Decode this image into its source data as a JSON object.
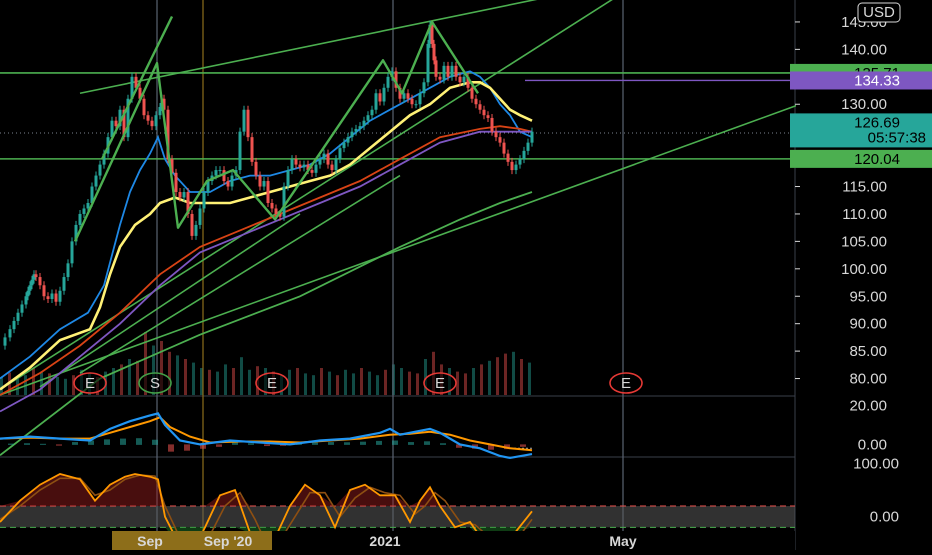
{
  "chart_data": {
    "type": "line",
    "currency": "USD",
    "price_axis": {
      "ylim": [
        77,
        149
      ],
      "ticks": [
        145,
        140,
        135,
        130,
        125,
        120,
        115,
        110,
        105,
        100,
        95,
        90,
        85,
        80
      ],
      "tick_labels": [
        "145.00",
        "140.00",
        "135.00",
        "130.00",
        "125.00",
        "120.00",
        "115.00",
        "110.00",
        "105.00",
        "100.00",
        "95.00",
        "90.00",
        "85.00",
        "80.00"
      ]
    },
    "price_tags": {
      "resistance": {
        "label": "135.71",
        "value": 135.71,
        "color": "#4caf50"
      },
      "alert": {
        "label": "134.33",
        "value": 134.33,
        "color": "#7e57c2"
      },
      "last": {
        "label": "126.69",
        "countdown": "05:57:38",
        "value": 126.69,
        "color": "#26a69a"
      },
      "support": {
        "label": "120.04",
        "value": 120.04,
        "color": "#4caf50"
      }
    },
    "close_series": {
      "name": "",
      "x": [
        0,
        5,
        10,
        14,
        18,
        22,
        26,
        28,
        30,
        32,
        34,
        36,
        40,
        44,
        48,
        52,
        56,
        60,
        64,
        68,
        72,
        76,
        80,
        84,
        88,
        92,
        96,
        100,
        104,
        108,
        112,
        116,
        120,
        124,
        128,
        132,
        136,
        140,
        144,
        148,
        152,
        156,
        160,
        162,
        164,
        168,
        172,
        176,
        180,
        184,
        188,
        192,
        196,
        200,
        204,
        208,
        212,
        216,
        220,
        224,
        228,
        232,
        236,
        240,
        244,
        248,
        252,
        256,
        260,
        264,
        268,
        272,
        276,
        280,
        284,
        288,
        292,
        296,
        300,
        304,
        308,
        312,
        316,
        320,
        324,
        328,
        332,
        336,
        340,
        344,
        348,
        352,
        356,
        360,
        364,
        368,
        372,
        376,
        380,
        384,
        388,
        392,
        396,
        400,
        404,
        408,
        412,
        416,
        420,
        424,
        428,
        430,
        432,
        434,
        436,
        440,
        444,
        448,
        452,
        456,
        460,
        464,
        468,
        472,
        476,
        480,
        484,
        488,
        492,
        496,
        500,
        504,
        508,
        512,
        516,
        520,
        524,
        528,
        532
      ],
      "y": [
        86,
        87.5,
        89,
        90.5,
        92,
        93.5,
        95,
        96,
        97,
        98,
        99,
        98.5,
        97,
        95,
        94.5,
        95.5,
        94,
        96,
        98.5,
        101,
        105,
        108,
        110,
        111,
        112,
        115,
        117,
        119,
        121,
        124,
        127,
        126,
        129,
        124,
        131,
        135,
        133,
        131,
        128,
        127,
        126,
        128,
        129.5,
        131,
        129,
        120,
        117.5,
        114,
        113,
        114,
        110,
        106,
        108,
        111,
        114,
        116,
        117,
        118,
        118,
        116,
        115,
        117,
        118,
        125,
        129,
        124,
        119.5,
        117,
        115,
        116,
        112,
        111,
        110,
        109.5,
        115,
        118,
        120,
        119,
        118.5,
        119,
        118,
        117.5,
        119,
        120,
        121,
        119,
        118,
        120,
        122,
        123,
        124,
        125,
        125.5,
        126,
        127,
        128,
        129,
        132,
        130.5,
        133,
        135,
        136,
        133,
        131,
        132,
        131,
        130,
        130,
        132,
        134,
        141,
        144.5,
        141,
        138,
        135,
        134.5,
        137,
        135,
        137,
        135,
        134,
        135,
        133,
        131,
        130,
        129,
        128,
        127.5,
        125,
        124,
        123,
        121,
        119.5,
        118,
        119,
        120,
        121.5,
        123,
        125,
        126.69
      ]
    },
    "ema_series": [
      {
        "name": "",
        "color": "#1e88e5",
        "x": [
          0,
          30,
          60,
          88,
          104,
          120,
          130,
          140,
          150,
          158,
          165,
          175,
          190,
          210,
          230,
          250,
          270,
          290,
          310,
          330,
          350,
          370,
          390,
          410,
          430,
          450,
          470,
          480,
          490,
          500,
          510,
          520,
          532
        ],
        "y": [
          80,
          84,
          89,
          92,
          97,
          108,
          114,
          118,
          121,
          124,
          120,
          117,
          114,
          114,
          116,
          117,
          117,
          118,
          119,
          121,
          124,
          127,
          129,
          131,
          133,
          135,
          136,
          135,
          133,
          130,
          128,
          125,
          124
        ]
      },
      {
        "name": "",
        "color": "#fff176",
        "x": [
          0,
          30,
          60,
          90,
          100,
          110,
          120,
          135,
          150,
          160,
          175,
          190,
          210,
          230,
          250,
          270,
          290,
          310,
          330,
          350,
          370,
          390,
          410,
          430,
          450,
          470,
          480,
          490,
          500,
          510,
          520,
          532
        ],
        "y": [
          78,
          82,
          87,
          89,
          93,
          99,
          104,
          108,
          110,
          112,
          113,
          112,
          112,
          112,
          113,
          114,
          115,
          116,
          117,
          119,
          122,
          125,
          128,
          130,
          133,
          134,
          134,
          133,
          131,
          129,
          128,
          127
        ]
      },
      {
        "name": "",
        "color": "#d84315",
        "x": [
          0,
          40,
          80,
          120,
          160,
          200,
          240,
          280,
          320,
          360,
          400,
          440,
          480,
          500,
          520,
          532
        ],
        "y": [
          77,
          81,
          86,
          92,
          99,
          104,
          107,
          110,
          113,
          116,
          120,
          124,
          125.5,
          126,
          125.5,
          125
        ]
      },
      {
        "name": "",
        "color": "#7e57c2",
        "x": [
          0,
          40,
          80,
          120,
          160,
          200,
          240,
          280,
          320,
          360,
          400,
          440,
          480,
          500,
          520,
          532
        ],
        "y": [
          74,
          78,
          84,
          90,
          97,
          103,
          106,
          109,
          112,
          115,
          119,
          123,
          125,
          125,
          125,
          125
        ]
      },
      {
        "name": "",
        "color": "#4caf50",
        "x": [
          0,
          100,
          200,
          300,
          400,
          460,
          500,
          532
        ],
        "y": [
          66,
          80,
          88,
          95,
          104,
          109,
          112,
          114
        ]
      }
    ],
    "trend_lines": [
      {
        "x1": 0,
        "y1": 78,
        "x2": 620,
        "y2": 150
      },
      {
        "x1": 80,
        "y1": 132,
        "x2": 800,
        "y2": 159
      },
      {
        "x1": 0,
        "y1": 77,
        "x2": 800,
        "y2": 130
      },
      {
        "x1": 80,
        "y1": 81,
        "x2": 400,
        "y2": 117
      },
      {
        "x1": 40,
        "y1": 78.5,
        "x2": 300,
        "y2": 110
      }
    ],
    "pattern_lines": [
      {
        "x": [
          75,
          157,
          178,
          207,
          233,
          275,
          383,
          402,
          432,
          478
        ],
        "y": [
          105,
          137.5,
          107.5,
          116,
          118,
          109,
          138,
          132,
          145,
          132
        ]
      },
      {
        "x": [
          102,
          172
        ],
        "y": [
          120,
          146
        ]
      }
    ],
    "horizontal_lines": [
      {
        "value": 135.71,
        "color": "#4caf50"
      },
      {
        "value": 120.04,
        "color": "#4caf50"
      }
    ],
    "vertical_lines": [
      {
        "x": 157,
        "color": "#5a6372"
      },
      {
        "x": 203,
        "color": "#8d6e1a"
      },
      {
        "x": 393,
        "color": "#5a6372"
      },
      {
        "x": 623,
        "color": "#5a6372"
      }
    ],
    "volume": {
      "ylim": [
        0,
        100
      ],
      "x": [
        0,
        8,
        16,
        24,
        32,
        40,
        48,
        56,
        64,
        72,
        80,
        88,
        96,
        104,
        112,
        120,
        128,
        136,
        144,
        152,
        160,
        168,
        176,
        184,
        192,
        200,
        208,
        216,
        224,
        232,
        240,
        248,
        256,
        264,
        272,
        280,
        288,
        296,
        304,
        312,
        320,
        328,
        336,
        344,
        352,
        360,
        368,
        376,
        384,
        392,
        400,
        408,
        416,
        424,
        432,
        440,
        448,
        456,
        464,
        472,
        480,
        488,
        496,
        504,
        512,
        520,
        528
      ],
      "values": [
        20,
        25,
        18,
        22,
        30,
        26,
        24,
        20,
        18,
        22,
        28,
        24,
        20,
        26,
        30,
        34,
        40,
        38,
        70,
        55,
        60,
        48,
        44,
        40,
        36,
        30,
        28,
        26,
        34,
        30,
        42,
        28,
        32,
        30,
        26,
        22,
        28,
        30,
        24,
        22,
        30,
        26,
        22,
        28,
        24,
        30,
        26,
        22,
        28,
        34,
        30,
        26,
        24,
        40,
        48,
        34,
        30,
        26,
        24,
        30,
        34,
        38,
        42,
        46,
        48,
        40,
        36
      ],
      "up": [
        1,
        0,
        1,
        1,
        0,
        1,
        0,
        1,
        1,
        0,
        1,
        1,
        0,
        1,
        1,
        0,
        1,
        0,
        0,
        1,
        0,
        0,
        1,
        0,
        1,
        1,
        0,
        1,
        1,
        0,
        1,
        1,
        0,
        1,
        0,
        1,
        1,
        0,
        1,
        1,
        0,
        1,
        0,
        1,
        1,
        0,
        1,
        1,
        0,
        1,
        1,
        0,
        0,
        1,
        0,
        0,
        1,
        0,
        0,
        1,
        0,
        1,
        0,
        0,
        1,
        0,
        1
      ]
    },
    "event_markers": [
      {
        "x": 90,
        "label": "E",
        "color": "#e53935"
      },
      {
        "x": 155,
        "label": "S",
        "color": "#43a047"
      },
      {
        "x": 272,
        "label": "E",
        "color": "#e53935"
      },
      {
        "x": 440,
        "label": "E",
        "color": "#e53935"
      },
      {
        "x": 626,
        "label": "E",
        "color": "#e53935"
      }
    ],
    "macd": {
      "ylim": [
        -6,
        25
      ],
      "tick_labels": [
        "20.00",
        "0.00"
      ],
      "ticks": [
        20,
        0
      ],
      "macd_line": {
        "name": "",
        "color": "#2196f3",
        "x": [
          0,
          30,
          60,
          90,
          110,
          130,
          150,
          158,
          165,
          180,
          200,
          230,
          260,
          290,
          320,
          350,
          380,
          390,
          400,
          420,
          430,
          440,
          460,
          480,
          500,
          510,
          532
        ],
        "y": [
          3,
          4,
          3,
          2,
          8,
          12,
          15,
          16,
          10,
          2,
          0,
          2,
          1,
          0,
          2,
          3,
          6,
          8,
          5,
          7,
          8,
          6,
          0,
          -2,
          -6,
          -7,
          -5
        ]
      },
      "signal_line": {
        "name": "",
        "color": "#ff9800",
        "x": [
          0,
          30,
          60,
          90,
          110,
          130,
          150,
          160,
          170,
          190,
          210,
          240,
          270,
          300,
          330,
          360,
          390,
          410,
          430,
          450,
          470,
          490,
          510,
          532
        ],
        "y": [
          3,
          3.5,
          3,
          3,
          6,
          9,
          12,
          14,
          9,
          4,
          1,
          1.5,
          1.5,
          1,
          2,
          3,
          5,
          5.5,
          6.5,
          5,
          2,
          0,
          -2,
          -3
        ]
      },
      "histogram": {
        "x": [
          8,
          24,
          40,
          56,
          72,
          88,
          104,
          120,
          136,
          152,
          168,
          184,
          200,
          216,
          232,
          248,
          264,
          280,
          296,
          312,
          328,
          344,
          360,
          376,
          392,
          408,
          424,
          440,
          456,
          472,
          488,
          504,
          520
        ],
        "values": [
          0.4,
          0.6,
          0.3,
          -0.4,
          1.2,
          2,
          2.6,
          3,
          3.2,
          2.4,
          -3.5,
          -3,
          -2,
          -1,
          1,
          0.6,
          -0.6,
          -0.5,
          0.8,
          1,
          1.2,
          1.1,
          1.4,
          1.8,
          2,
          1.2,
          1.6,
          0.6,
          -1.5,
          -2,
          -2.5,
          -2.2,
          -1
        ]
      }
    },
    "stoch": {
      "ylim": [
        -25,
        110
      ],
      "tick_labels": [
        "100.00",
        "0.00"
      ],
      "ticks": [
        100,
        0
      ],
      "bands": [
        20,
        -20
      ],
      "k_line": {
        "name": "",
        "color": "#ff9800",
        "x": [
          0,
          20,
          40,
          60,
          80,
          95,
          110,
          125,
          135,
          150,
          158,
          165,
          180,
          195,
          205,
          220,
          235,
          250,
          260,
          275,
          290,
          305,
          320,
          335,
          350,
          365,
          380,
          395,
          410,
          420,
          430,
          440,
          455,
          470,
          485,
          500,
          515,
          532
        ],
        "y": [
          -10,
          30,
          60,
          80,
          70,
          30,
          60,
          75,
          80,
          75,
          70,
          0,
          -55,
          -58,
          -20,
          40,
          50,
          -30,
          -55,
          -40,
          20,
          60,
          40,
          -20,
          50,
          60,
          40,
          40,
          -10,
          30,
          55,
          20,
          -20,
          -10,
          -50,
          -55,
          -30,
          10
        ]
      },
      "d_line": {
        "name": "",
        "color": "#8d4f12",
        "x": [
          0,
          20,
          40,
          60,
          80,
          95,
          110,
          125,
          140,
          155,
          165,
          180,
          195,
          210,
          225,
          240,
          255,
          265,
          280,
          295,
          310,
          325,
          340,
          355,
          370,
          385,
          400,
          415,
          425,
          435,
          445,
          460,
          475,
          490,
          505,
          520,
          532
        ],
        "y": [
          -5,
          20,
          50,
          72,
          72,
          40,
          50,
          70,
          78,
          76,
          20,
          -40,
          -55,
          -35,
          20,
          45,
          -5,
          -45,
          -45,
          0,
          45,
          45,
          0,
          35,
          55,
          45,
          40,
          5,
          20,
          45,
          30,
          -10,
          -15,
          -40,
          -50,
          -35,
          -5
        ]
      }
    },
    "time_axis": {
      "labels": [
        {
          "text": "Sep",
          "x": 150
        },
        {
          "text": "Sep '20",
          "x": 228
        },
        {
          "text": "2021",
          "x": 385
        },
        {
          "text": "May",
          "x": 623
        }
      ]
    }
  }
}
